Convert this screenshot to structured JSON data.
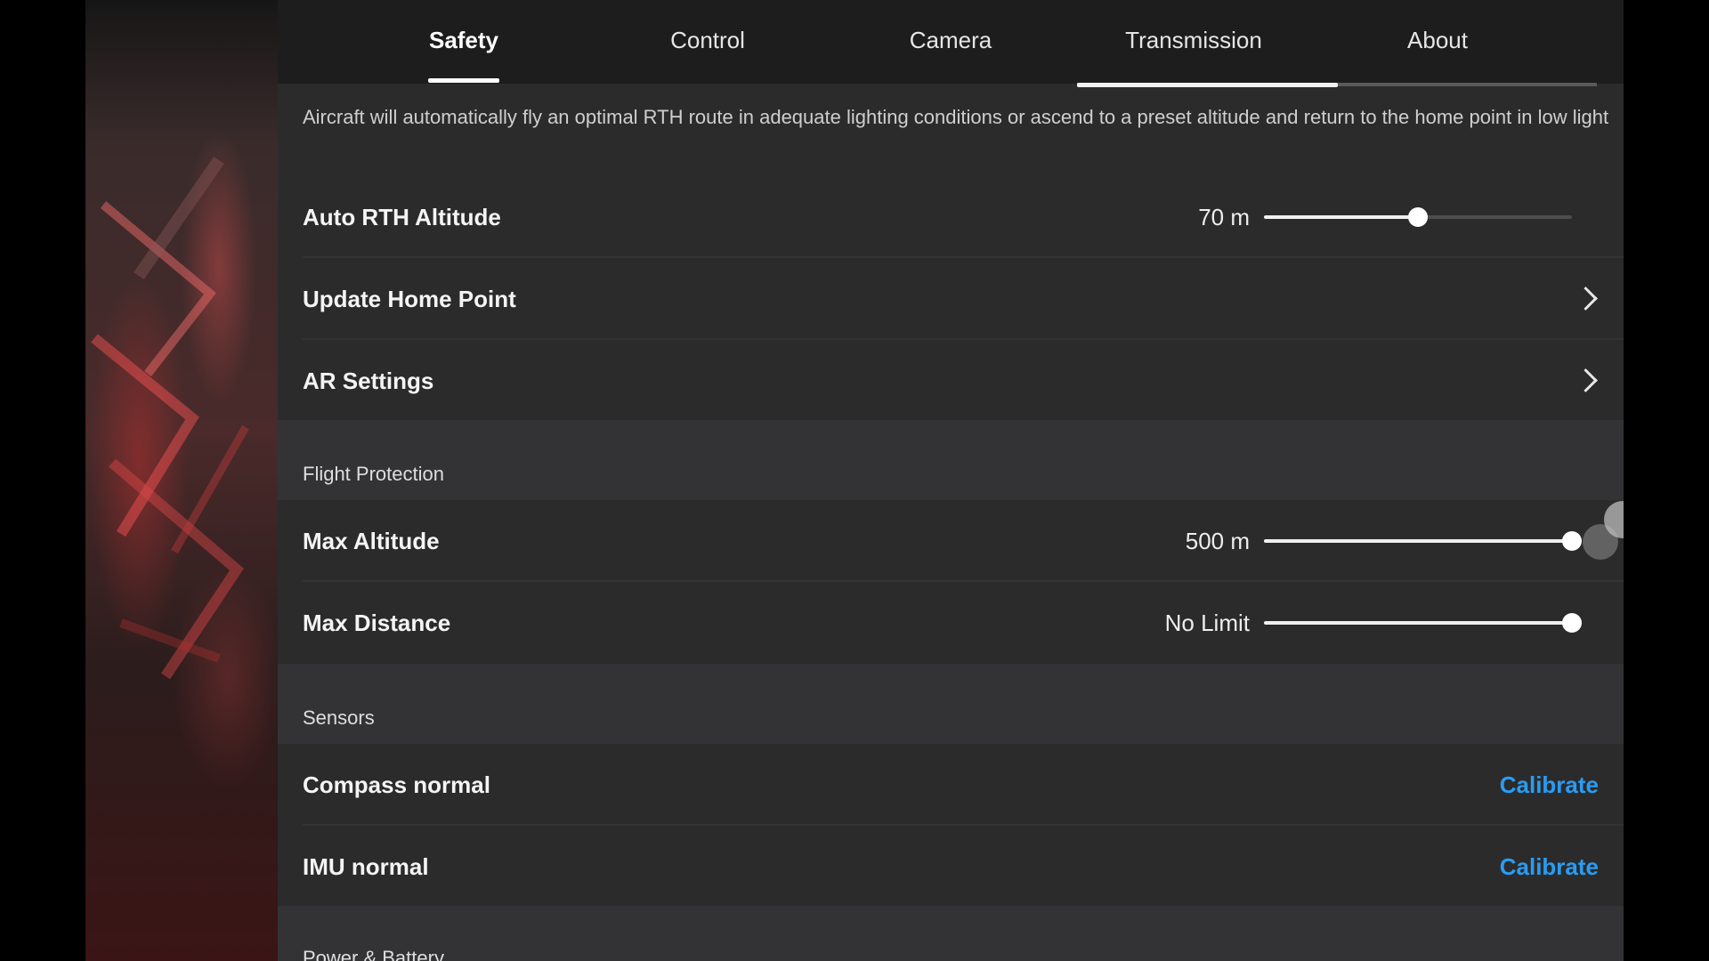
{
  "tabs": [
    {
      "label": "Safety",
      "active": true
    },
    {
      "label": "Control",
      "active": false
    },
    {
      "label": "Camera",
      "active": false
    },
    {
      "label": "Transmission",
      "active": false
    },
    {
      "label": "About",
      "active": false
    }
  ],
  "description": "Aircraft will automatically fly an optimal RTH route in adequate lighting conditions or ascend to a preset altitude and return to the home point in low light",
  "auto_rth_altitude": {
    "label": "Auto RTH Altitude",
    "value": "70 m",
    "slider_fraction": 0.5
  },
  "update_home_point": {
    "label": "Update Home Point"
  },
  "ar_settings": {
    "label": "AR Settings"
  },
  "flight_protection": {
    "title": "Flight Protection",
    "max_altitude": {
      "label": "Max Altitude",
      "value": "500 m",
      "slider_fraction": 1.0
    },
    "max_distance": {
      "label": "Max Distance",
      "value": "No Limit",
      "slider_fraction": 1.0
    }
  },
  "sensors": {
    "title": "Sensors",
    "compass": {
      "label": "Compass normal",
      "action": "Calibrate"
    },
    "imu": {
      "label": "IMU normal",
      "action": "Calibrate"
    }
  },
  "power_battery": {
    "title": "Power & Battery"
  },
  "colors": {
    "accent": "#2a9cf2",
    "panel": "#2b2b2c",
    "section": "#333335"
  }
}
